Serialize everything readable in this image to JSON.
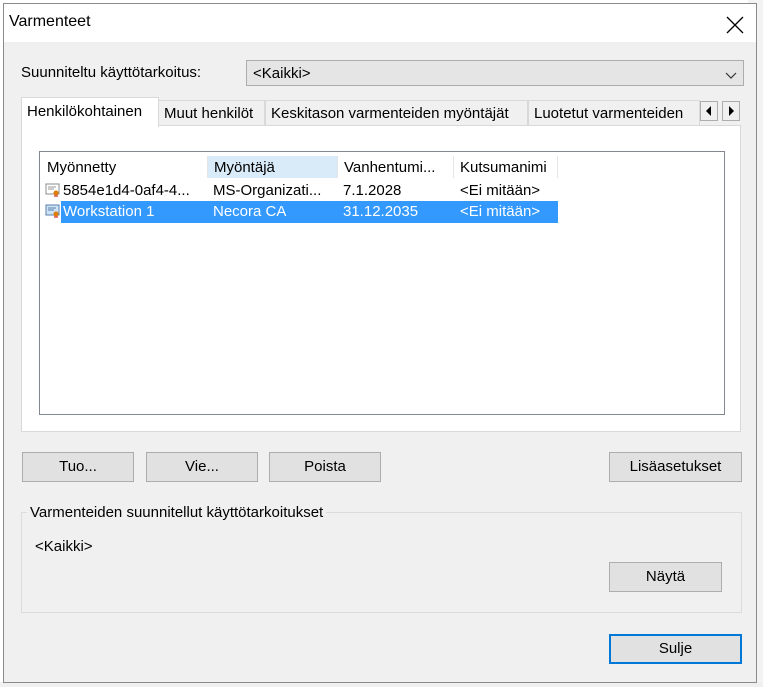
{
  "window": {
    "title": "Varmenteet"
  },
  "purpose": {
    "label": "Suunniteltu käyttötarkoitus:",
    "value": "<Kaikki>"
  },
  "tabs": [
    {
      "label": "Henkilökohtainen"
    },
    {
      "label": "Muut henkilöt"
    },
    {
      "label": "Keskitason varmenteiden myöntäjät"
    },
    {
      "label": "Luotetut varmenteiden"
    }
  ],
  "list": {
    "columns": [
      "Myönnetty",
      "Myöntäjä",
      "Vanhentumi...",
      "Kutsumanimi"
    ],
    "rows": [
      {
        "issued_to": "5854e1d4-0af4-4...",
        "issuer": "MS-Organizati...",
        "expires": "7.1.2028",
        "friendly_name": "<Ei mitään>",
        "icon": "certificate-icon"
      },
      {
        "issued_to": "Workstation 1",
        "issuer": "Necora CA",
        "expires": "31.12.2035",
        "friendly_name": "<Ei mitään>",
        "icon": "certificate-icon",
        "selected": true
      }
    ]
  },
  "buttons": {
    "import": "Tuo...",
    "export": "Vie...",
    "remove": "Poista",
    "advanced": "Lisäasetukset",
    "view": "Näytä",
    "close": "Sulje"
  },
  "purposes_group": {
    "title": "Varmenteiden suunnitellut käyttötarkoitukset",
    "value": "<Kaikki>"
  },
  "colors": {
    "selection": "#3399ff",
    "sorted_header": "#d9ebf9",
    "default_button_border": "#0078d7"
  }
}
